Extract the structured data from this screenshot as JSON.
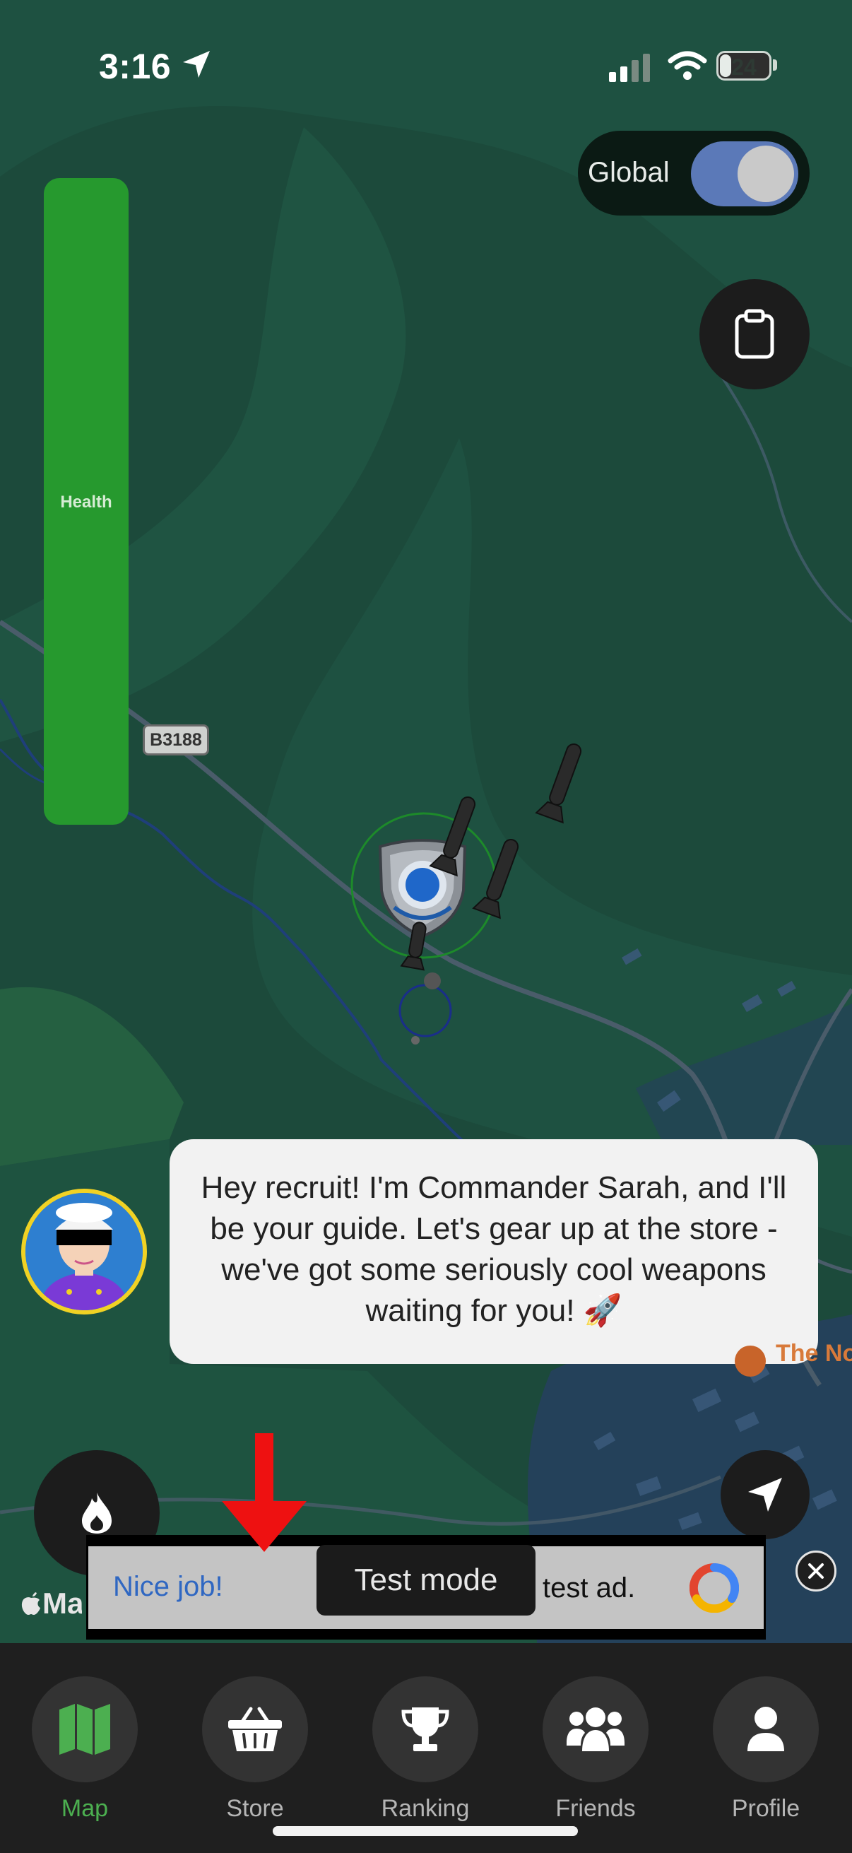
{
  "status_bar": {
    "time": "3:16",
    "battery": "24",
    "battery_level": 0.24
  },
  "global_toggle": {
    "label": "Global",
    "on": true
  },
  "health": {
    "label": "Health",
    "level": 1.0
  },
  "map": {
    "road_label": "B3188",
    "poi_label": "The Nor Arms Inn",
    "attribution": "Maps"
  },
  "guide": {
    "message": "Hey recruit! I'm Commander Sarah, and I'll be your guide. Let's gear up at the store - we've got some seriously cool weapons waiting for you! 🚀"
  },
  "ad": {
    "left_text": "Nice job!",
    "badge": "Test mode",
    "right_text": "test ad."
  },
  "tabs": [
    {
      "label": "Map",
      "icon": "map-icon",
      "active": true
    },
    {
      "label": "Store",
      "icon": "basket-icon",
      "active": false
    },
    {
      "label": "Ranking",
      "icon": "trophy-icon",
      "active": false
    },
    {
      "label": "Friends",
      "icon": "friends-icon",
      "active": false
    },
    {
      "label": "Profile",
      "icon": "profile-icon",
      "active": false
    }
  ],
  "colors": {
    "accent_green": "#4caf50",
    "health_green": "#26992e",
    "toggle_blue": "#5b79b8",
    "map_bg": "#1c4a3b"
  }
}
